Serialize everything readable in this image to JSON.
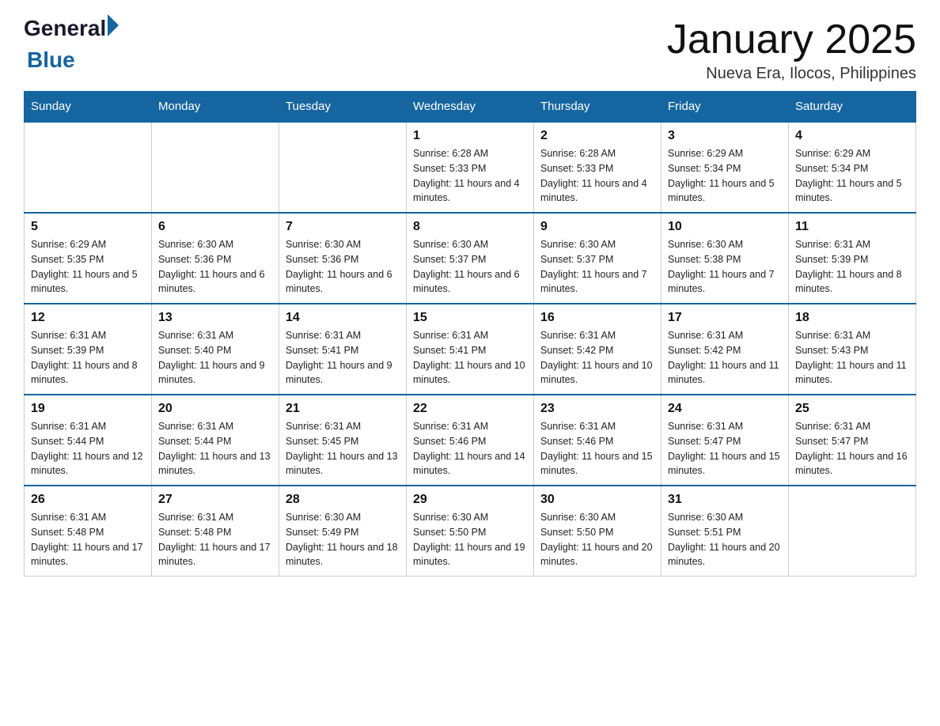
{
  "header": {
    "logo": {
      "general": "General",
      "blue": "Blue"
    },
    "title": "January 2025",
    "subtitle": "Nueva Era, Ilocos, Philippines"
  },
  "weekdays": [
    "Sunday",
    "Monday",
    "Tuesday",
    "Wednesday",
    "Thursday",
    "Friday",
    "Saturday"
  ],
  "weeks": [
    [
      {
        "day": "",
        "info": ""
      },
      {
        "day": "",
        "info": ""
      },
      {
        "day": "",
        "info": ""
      },
      {
        "day": "1",
        "info": "Sunrise: 6:28 AM\nSunset: 5:33 PM\nDaylight: 11 hours and 4 minutes."
      },
      {
        "day": "2",
        "info": "Sunrise: 6:28 AM\nSunset: 5:33 PM\nDaylight: 11 hours and 4 minutes."
      },
      {
        "day": "3",
        "info": "Sunrise: 6:29 AM\nSunset: 5:34 PM\nDaylight: 11 hours and 5 minutes."
      },
      {
        "day": "4",
        "info": "Sunrise: 6:29 AM\nSunset: 5:34 PM\nDaylight: 11 hours and 5 minutes."
      }
    ],
    [
      {
        "day": "5",
        "info": "Sunrise: 6:29 AM\nSunset: 5:35 PM\nDaylight: 11 hours and 5 minutes."
      },
      {
        "day": "6",
        "info": "Sunrise: 6:30 AM\nSunset: 5:36 PM\nDaylight: 11 hours and 6 minutes."
      },
      {
        "day": "7",
        "info": "Sunrise: 6:30 AM\nSunset: 5:36 PM\nDaylight: 11 hours and 6 minutes."
      },
      {
        "day": "8",
        "info": "Sunrise: 6:30 AM\nSunset: 5:37 PM\nDaylight: 11 hours and 6 minutes."
      },
      {
        "day": "9",
        "info": "Sunrise: 6:30 AM\nSunset: 5:37 PM\nDaylight: 11 hours and 7 minutes."
      },
      {
        "day": "10",
        "info": "Sunrise: 6:30 AM\nSunset: 5:38 PM\nDaylight: 11 hours and 7 minutes."
      },
      {
        "day": "11",
        "info": "Sunrise: 6:31 AM\nSunset: 5:39 PM\nDaylight: 11 hours and 8 minutes."
      }
    ],
    [
      {
        "day": "12",
        "info": "Sunrise: 6:31 AM\nSunset: 5:39 PM\nDaylight: 11 hours and 8 minutes."
      },
      {
        "day": "13",
        "info": "Sunrise: 6:31 AM\nSunset: 5:40 PM\nDaylight: 11 hours and 9 minutes."
      },
      {
        "day": "14",
        "info": "Sunrise: 6:31 AM\nSunset: 5:41 PM\nDaylight: 11 hours and 9 minutes."
      },
      {
        "day": "15",
        "info": "Sunrise: 6:31 AM\nSunset: 5:41 PM\nDaylight: 11 hours and 10 minutes."
      },
      {
        "day": "16",
        "info": "Sunrise: 6:31 AM\nSunset: 5:42 PM\nDaylight: 11 hours and 10 minutes."
      },
      {
        "day": "17",
        "info": "Sunrise: 6:31 AM\nSunset: 5:42 PM\nDaylight: 11 hours and 11 minutes."
      },
      {
        "day": "18",
        "info": "Sunrise: 6:31 AM\nSunset: 5:43 PM\nDaylight: 11 hours and 11 minutes."
      }
    ],
    [
      {
        "day": "19",
        "info": "Sunrise: 6:31 AM\nSunset: 5:44 PM\nDaylight: 11 hours and 12 minutes."
      },
      {
        "day": "20",
        "info": "Sunrise: 6:31 AM\nSunset: 5:44 PM\nDaylight: 11 hours and 13 minutes."
      },
      {
        "day": "21",
        "info": "Sunrise: 6:31 AM\nSunset: 5:45 PM\nDaylight: 11 hours and 13 minutes."
      },
      {
        "day": "22",
        "info": "Sunrise: 6:31 AM\nSunset: 5:46 PM\nDaylight: 11 hours and 14 minutes."
      },
      {
        "day": "23",
        "info": "Sunrise: 6:31 AM\nSunset: 5:46 PM\nDaylight: 11 hours and 15 minutes."
      },
      {
        "day": "24",
        "info": "Sunrise: 6:31 AM\nSunset: 5:47 PM\nDaylight: 11 hours and 15 minutes."
      },
      {
        "day": "25",
        "info": "Sunrise: 6:31 AM\nSunset: 5:47 PM\nDaylight: 11 hours and 16 minutes."
      }
    ],
    [
      {
        "day": "26",
        "info": "Sunrise: 6:31 AM\nSunset: 5:48 PM\nDaylight: 11 hours and 17 minutes."
      },
      {
        "day": "27",
        "info": "Sunrise: 6:31 AM\nSunset: 5:48 PM\nDaylight: 11 hours and 17 minutes."
      },
      {
        "day": "28",
        "info": "Sunrise: 6:30 AM\nSunset: 5:49 PM\nDaylight: 11 hours and 18 minutes."
      },
      {
        "day": "29",
        "info": "Sunrise: 6:30 AM\nSunset: 5:50 PM\nDaylight: 11 hours and 19 minutes."
      },
      {
        "day": "30",
        "info": "Sunrise: 6:30 AM\nSunset: 5:50 PM\nDaylight: 11 hours and 20 minutes."
      },
      {
        "day": "31",
        "info": "Sunrise: 6:30 AM\nSunset: 5:51 PM\nDaylight: 11 hours and 20 minutes."
      },
      {
        "day": "",
        "info": ""
      }
    ]
  ]
}
